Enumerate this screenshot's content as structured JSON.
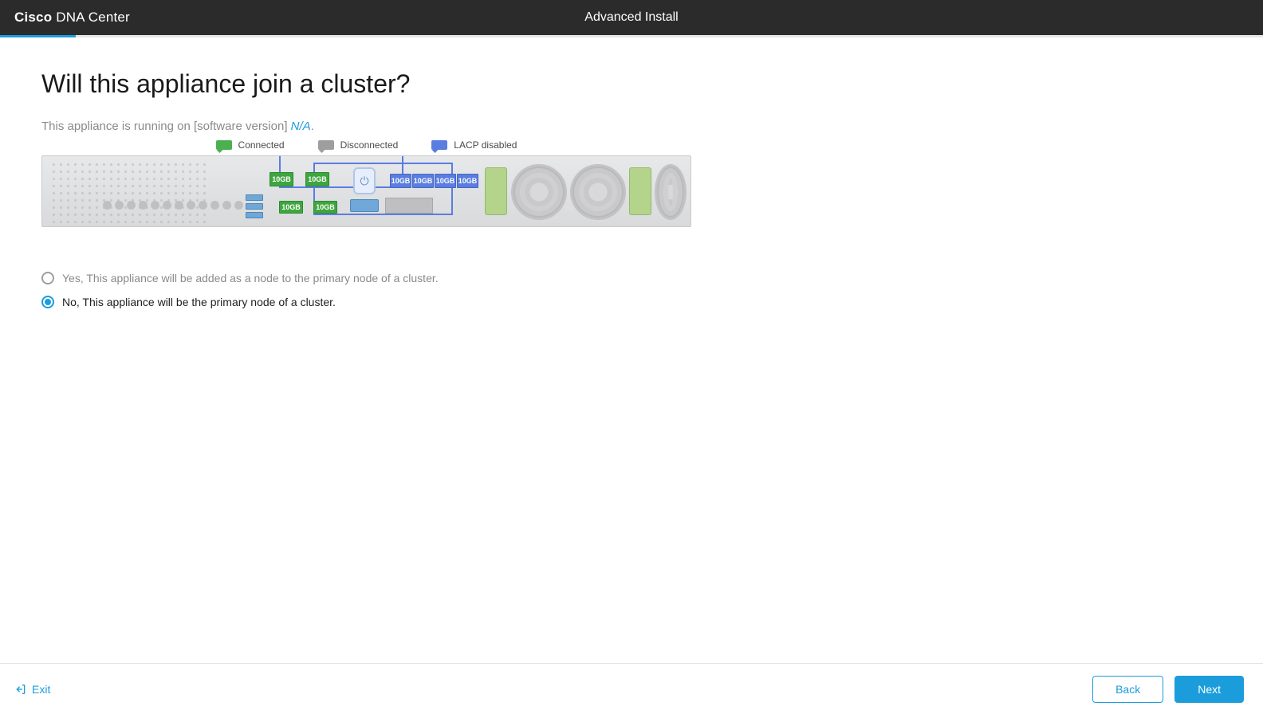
{
  "header": {
    "brand_bold": "Cisco",
    "brand_rest": " DNA Center",
    "title": "Advanced Install"
  },
  "progress_percent": 6,
  "page": {
    "title": "Will this appliance join a cluster?",
    "subtext_prefix": "This appliance is running on [software version] ",
    "subtext_na": "N/A",
    "subtext_suffix": "."
  },
  "legend": {
    "connected": "Connected",
    "disconnected": "Disconnected",
    "lacp": "LACP disabled"
  },
  "ports": {
    "green_top1": "10GB",
    "green_top2": "10GB",
    "green_bot1": "10GB",
    "green_bot2": "10GB",
    "blue1": "10GB",
    "blue2": "10GB",
    "blue3": "10GB",
    "blue4": "10GB"
  },
  "options": {
    "yes": "Yes, This appliance will be added as a node to the primary node of a cluster.",
    "no": "No, This appliance will be the primary node of a cluster.",
    "selected": "no"
  },
  "footer": {
    "exit": "Exit",
    "back": "Back",
    "next": "Next"
  }
}
